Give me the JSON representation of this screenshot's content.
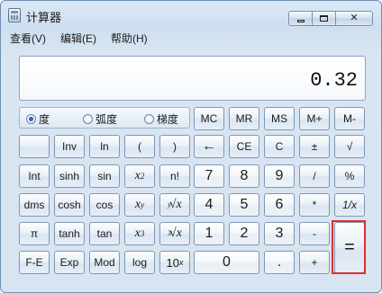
{
  "window": {
    "title": "计算器"
  },
  "menu": {
    "view": "查看(V)",
    "edit": "编辑(E)",
    "help": "帮助(H)"
  },
  "display": {
    "value": "0.32"
  },
  "angle": {
    "degrees": "度",
    "radians": "弧度",
    "grads": "梯度",
    "selected": "degrees"
  },
  "memory": {
    "mc": "MC",
    "mr": "MR",
    "ms": "MS",
    "mplus": "M+",
    "mminus": "M-"
  },
  "sci": {
    "inv": "Inv",
    "ln": "ln",
    "lparen": "(",
    "rparen": ")",
    "int": "Int",
    "sinh": "sinh",
    "sin": "sin",
    "x2": "x",
    "x2_exp": "2",
    "nfact": "n!",
    "dms": "dms",
    "cosh": "cosh",
    "cos": "cos",
    "xy": "x",
    "xy_exp": "y",
    "yroot_idx": "y",
    "yroot": "√x",
    "pi": "π",
    "tanh": "tanh",
    "tan": "tan",
    "x3": "x",
    "x3_exp": "3",
    "cuberoot_idx": "3",
    "cuberoot": "√x",
    "fe": "F-E",
    "exp": "Exp",
    "mod": "Mod",
    "log": "log",
    "tenx": "10",
    "tenx_exp": "x"
  },
  "std": {
    "backspace": "←",
    "ce": "CE",
    "c": "C",
    "plusminus": "±",
    "sqrt": "√",
    "d7": "7",
    "d8": "8",
    "d9": "9",
    "divide": "/",
    "percent": "%",
    "d4": "4",
    "d5": "5",
    "d6": "6",
    "multiply": "*",
    "reciprocal": "1/x",
    "d1": "1",
    "d2": "2",
    "d3": "3",
    "subtract": "-",
    "equals": "=",
    "d0": "0",
    "dot": ".",
    "add": "+"
  }
}
